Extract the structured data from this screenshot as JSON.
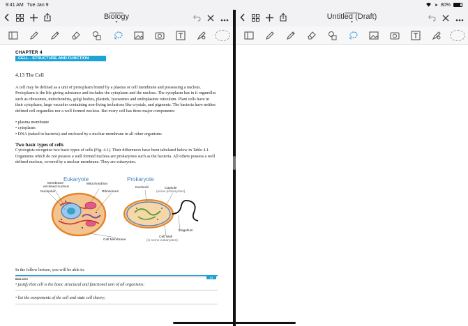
{
  "status": {
    "time": "9:41 AM",
    "date": "Tue Jan 9",
    "battery": "80%"
  },
  "left": {
    "title": "Biology",
    "chapter": "CHAPTER 4",
    "chapter_subtitle": "CELL - STRUCTURE AND FUNCTION",
    "section_title": "4.13  The Cell",
    "para1": "A cell may be defined as a unit of protoplasm bound by a plasma or cell membrane and possessing a nucleus. Protoplasm is the life giving substance and includes the cytoplasm and the nucleus. The cytoplasm has in it organelles such as ribosomes, mitochondria, golgi bodies, plastids, lysosomes and endoplasmic reticulum. Plant cells have in their cytoplasm, large vacuoles containing non-living inclusions like crystals, and pigments. The bacteria have neither defined cell organelles nor a well formed nucleus. But every cell has three major components:",
    "bullets": [
      "plasma membrane",
      "cytoplasm",
      "DNA (naked in bacteria) and enclosed by a nuclear membrane in all other organisms"
    ],
    "subsection_title": "Two basic types of cells",
    "para2": "Cytologists recognize two basic types of cells (Fig. 4.1). Their differences have been tabulated below in Table 4.1. Organisms which do not possess a well formed nucleus are prokaryotes such as the bacteria. All others possess a well defined nucleus, covered by a nuclear membrane. They are eukaryotes.",
    "figure": {
      "eukaryote": "Eukaryote",
      "prokaryote": "Prokaryote",
      "labels": {
        "membrane": "Membrane-",
        "enclosed": "enclosed nucleus",
        "mitochondrion": "Mitochondrion",
        "nucleolus": "Nucleolus",
        "ribosomes": "Ribosomes",
        "nucleoid": "Nucleoid",
        "capsule": "Capsule",
        "capsule_note": "(some prokaryotes)",
        "flagellum": "Flagellum",
        "cell_wall": "Cell Wall",
        "cell_wall_note": "(in some eukaryotes)",
        "cell_membrane": "Cell Membrane"
      }
    },
    "learn_intro": "In the follow lecture, you will be able to:",
    "objectives": [
      "• justify that cell is the basic structural and functional unit of all organisms;",
      "• list the components of the cell and state cell theory;"
    ],
    "footer_label": "BIOLOGY",
    "footer_page": "54"
  },
  "right": {
    "title": "Untitled (Draft)"
  },
  "colors": {
    "accent": "#1ea3d7",
    "figure_head": "#3b7fc2"
  },
  "icons": [
    "chevron-left-icon",
    "grid-icon",
    "plus-icon",
    "share-icon",
    "undo-icon",
    "close-icon",
    "more-icon",
    "sidebar-icon",
    "pen-icon",
    "pencil-icon",
    "eraser-icon",
    "shapes-icon",
    "lasso-icon",
    "image-icon",
    "camera-icon",
    "textbox-icon",
    "highlighter-icon",
    "dashed-lasso-icon"
  ]
}
